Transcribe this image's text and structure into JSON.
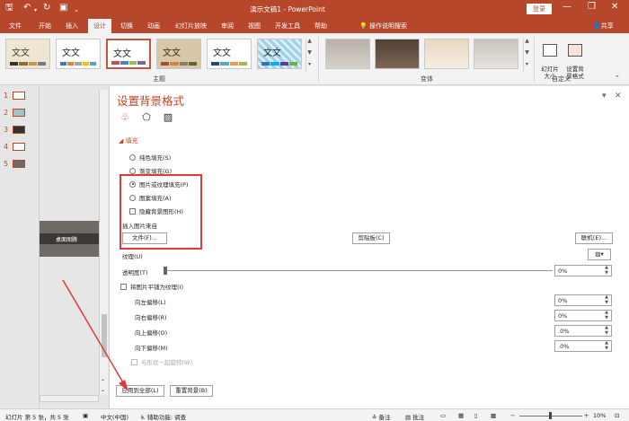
{
  "titlebar": {
    "title": "演示文稿1  -  PowerPoint",
    "login": "登录",
    "minimize": "—",
    "restore": "❐",
    "close": "✕"
  },
  "tabs": [
    "文件",
    "开始",
    "插入",
    "设计",
    "切换",
    "动画",
    "幻灯片放映",
    "审阅",
    "视图",
    "开发工具",
    "帮助"
  ],
  "active_tab": "设计",
  "tell_me": "操作说明搜索",
  "share": "共享",
  "ribbon": {
    "group_theme": "主题",
    "group_variant": "变体",
    "group_custom": "自定义",
    "themes": [
      "文文",
      "文文",
      "文文",
      "文文",
      "文文",
      "文文"
    ],
    "slide_size": "幻灯片\n大小",
    "format_bg": "设置背\n景格式"
  },
  "slides": [
    "1",
    "2",
    "3",
    "4",
    "5"
  ],
  "slide_preview_text": "桌面图腾",
  "pane": {
    "title": "设置背景格式",
    "section_fill": "填充",
    "solid_fill": "纯色填充(S)",
    "gradient_fill": "渐变填充(G)",
    "picture_fill": "图片或纹理填充(P)",
    "pattern_fill": "图案填充(A)",
    "hide_bg_graphics": "隐藏背景图形(H)",
    "insert_from": "插入图片来自",
    "file_button": "文件(F)...",
    "clipboard_button": "剪贴板(C)",
    "online_button": "联机(E)...",
    "texture_label": "纹理(U)",
    "transparency_label": "透明度(T)",
    "transparency_value": "0%",
    "tile_label": "将图片平铺为纹理(I)",
    "offset_left_label": "向左偏移(L)",
    "offset_left_value": "0%",
    "offset_right_label": "向右偏移(R)",
    "offset_right_value": "0%",
    "offset_top_label": "向上偏移(O)",
    "offset_top_value": ".0%",
    "offset_bottom_label": "向下偏移(M)",
    "offset_bottom_value": ".0%",
    "rotate_with_shape": "与形状一起旋转(W)",
    "apply_all_button": "应用到全部(L)",
    "reset_button": "重置背景(B)"
  },
  "status": {
    "slide_info": "幻灯片 第 5 张，共 5 张",
    "language": "中文(中国)",
    "accessibility": "辅助功能: 调查",
    "notes": "备注",
    "comments": "批注",
    "zoom": "10%"
  },
  "colors": {
    "accent": "#b7472a",
    "highlight_box": "#e23a3a"
  }
}
